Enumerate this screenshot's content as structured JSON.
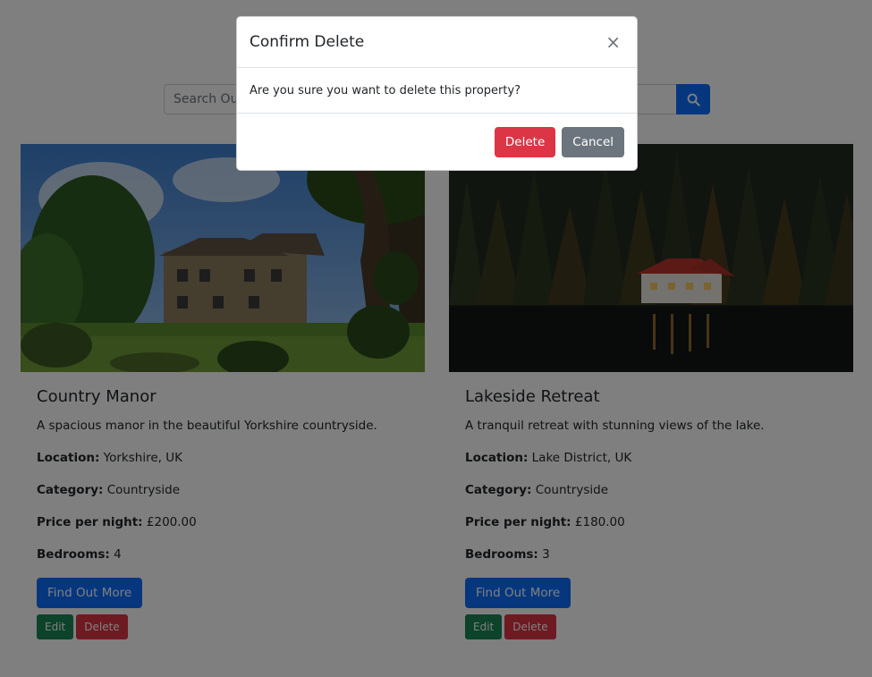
{
  "search": {
    "placeholder": "Search Our Properties"
  },
  "properties": [
    {
      "title": "Country Manor",
      "description": "A spacious manor in the beautiful Yorkshire countryside.",
      "location_label": "Location:",
      "location": "Yorkshire, UK",
      "category_label": "Category:",
      "category": "Countryside",
      "price_label": "Price per night:",
      "price": "£200.00",
      "bedrooms_label": "Bedrooms:",
      "bedrooms": "4",
      "find_out_more": "Find Out More",
      "edit": "Edit",
      "delete": "Delete"
    },
    {
      "title": "Lakeside Retreat",
      "description": "A tranquil retreat with stunning views of the lake.",
      "location_label": "Location:",
      "location": "Lake District, UK",
      "category_label": "Category:",
      "category": "Countryside",
      "price_label": "Price per night:",
      "price": "£180.00",
      "bedrooms_label": "Bedrooms:",
      "bedrooms": "3",
      "find_out_more": "Find Out More",
      "edit": "Edit",
      "delete": "Delete"
    }
  ],
  "modal": {
    "title": "Confirm Delete",
    "close": "×",
    "body": "Are you sure you want to delete this property?",
    "confirm": "Delete",
    "cancel": "Cancel"
  },
  "colors": {
    "primary": "#0d6efd",
    "danger": "#dc3545",
    "success": "#198754",
    "secondary": "#6c757d",
    "backdrop": "rgba(0,0,0,0.5)"
  }
}
